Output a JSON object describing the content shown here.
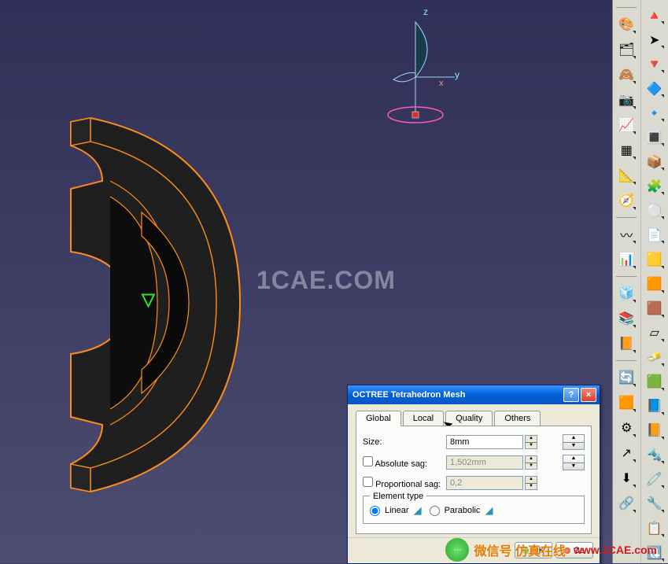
{
  "watermark": "1CAE.COM",
  "compass": {
    "z": "z",
    "y": "y",
    "x": "x"
  },
  "dialog": {
    "title": "OCTREE Tetrahedron Mesh",
    "tabs": {
      "global": "Global",
      "local": "Local",
      "quality": "Quality",
      "others": "Others"
    },
    "size_label": "Size:",
    "size_value": "8mm",
    "abs_sag_label": "Absolute sag:",
    "abs_sag_value": "1,502mm",
    "prop_sag_label": "Proportional sag:",
    "prop_sag_value": "0,2",
    "element_type_label": "Element type",
    "linear_label": "Linear",
    "parabolic_label": "Parabolic",
    "ok": "OK",
    "cancel": "Ca"
  },
  "footer": {
    "label": "微信号 仿真在线",
    "url": "www.1CAE.com"
  },
  "tools_left": [
    {
      "name": "handle-icon",
      "g": "≡"
    },
    {
      "name": "paint-icon",
      "g": "🎨"
    },
    {
      "name": "layers-icon",
      "g": "🗂"
    },
    {
      "name": "hide-icon",
      "g": "🙈"
    },
    {
      "name": "camera-icon",
      "g": "📷"
    },
    {
      "name": "chart-icon",
      "g": "📈"
    },
    {
      "name": "mesh-local-icon",
      "g": "▦"
    },
    {
      "name": "measure-icon",
      "g": "📐"
    },
    {
      "name": "compass-icon",
      "g": "🧭"
    },
    {
      "name": "handle2-icon",
      "g": "≡"
    },
    {
      "name": "curve-icon",
      "g": "〰"
    },
    {
      "name": "sensor-icon",
      "g": "📊"
    },
    {
      "name": "handle3-icon",
      "g": "≡"
    },
    {
      "name": "cube-icon",
      "g": "🧊"
    },
    {
      "name": "book-icon",
      "g": "📚"
    },
    {
      "name": "catalog-icon",
      "g": "📙"
    },
    {
      "name": "handle4-icon",
      "g": "≡"
    },
    {
      "name": "update-icon",
      "g": "🔄"
    },
    {
      "name": "virtual-icon",
      "g": "🟧"
    },
    {
      "name": "spring-icon",
      "g": "⚙"
    },
    {
      "name": "force-icon",
      "g": "↗"
    },
    {
      "name": "pressure-icon",
      "g": "⬇"
    },
    {
      "name": "constraint-icon",
      "g": "🔗"
    }
  ],
  "tools_right": [
    {
      "name": "tetra-icon",
      "g": "🔺"
    },
    {
      "name": "select-icon",
      "g": "➤"
    },
    {
      "name": "cone-icon",
      "g": "🔻"
    },
    {
      "name": "prism-icon",
      "g": "🔷"
    },
    {
      "name": "pyramid-icon",
      "g": "🔹"
    },
    {
      "name": "wire-icon",
      "g": "🔳"
    },
    {
      "name": "box-icon",
      "g": "📦"
    },
    {
      "name": "analysis-icon",
      "g": "🧩"
    },
    {
      "name": "sphere-icon",
      "g": "⚪"
    },
    {
      "name": "sheet-icon",
      "g": "📄"
    },
    {
      "name": "stack1-icon",
      "g": "🟨"
    },
    {
      "name": "stack2-icon",
      "g": "🟧"
    },
    {
      "name": "stack3-icon",
      "g": "🟫"
    },
    {
      "name": "plane-icon",
      "g": "▱"
    },
    {
      "name": "solid-yellow-icon",
      "g": "🧈"
    },
    {
      "name": "solid-green-icon",
      "g": "🟩"
    },
    {
      "name": "layers-blue-icon",
      "g": "📘"
    },
    {
      "name": "layers-orange-icon",
      "g": "📙"
    },
    {
      "name": "welding-icon",
      "g": "🔩"
    },
    {
      "name": "connect-icon",
      "g": "🧷"
    },
    {
      "name": "bolt-icon",
      "g": "🔧"
    },
    {
      "name": "list-icon",
      "g": "📋"
    },
    {
      "name": "refresh-icon",
      "g": "🔃"
    }
  ]
}
